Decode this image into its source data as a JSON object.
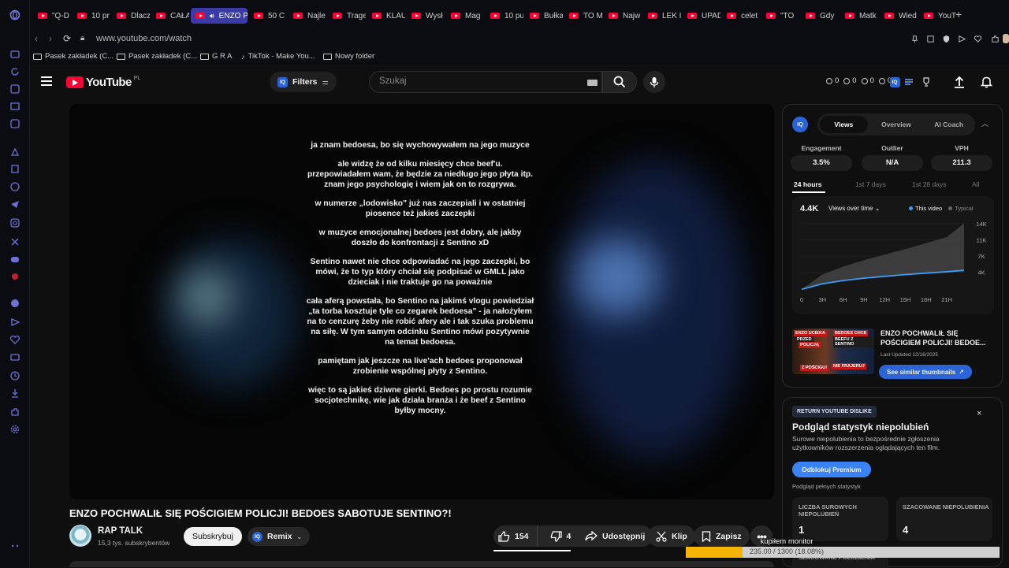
{
  "browser": {
    "tabs": [
      {
        "label": "\"Q-D",
        "active": false
      },
      {
        "label": "10 pr",
        "active": false
      },
      {
        "label": "Dlacz",
        "active": false
      },
      {
        "label": "CAŁA",
        "active": false
      },
      {
        "label": "ENZO P",
        "active": true
      },
      {
        "label": "50 C",
        "active": false
      },
      {
        "label": "Najle",
        "active": false
      },
      {
        "label": "Trage",
        "active": false
      },
      {
        "label": "KLAU",
        "active": false
      },
      {
        "label": "Wysł",
        "active": false
      },
      {
        "label": "Mag",
        "active": false
      },
      {
        "label": "10 pu",
        "active": false
      },
      {
        "label": "Bułka",
        "active": false
      },
      {
        "label": "TO M",
        "active": false
      },
      {
        "label": "Najw",
        "active": false
      },
      {
        "label": "LEK I",
        "active": false
      },
      {
        "label": "UPAD",
        "active": false
      },
      {
        "label": "celet",
        "active": false
      },
      {
        "label": "\"TO",
        "active": false
      },
      {
        "label": "Gdy",
        "active": false
      },
      {
        "label": "Matk",
        "active": false
      },
      {
        "label": "Wied",
        "active": false
      },
      {
        "label": "YouT",
        "active": false
      }
    ],
    "url": "www.youtube.com/watch",
    "bookmarks": [
      {
        "label": "Pasek zakładek (C...",
        "icon": "folder-icon"
      },
      {
        "label": "Pasek zakładek (C...",
        "icon": "folder-icon"
      },
      {
        "label": "G R A",
        "icon": "folder-icon"
      },
      {
        "label": "TikTok - Make You...",
        "icon": "tiktok-icon"
      },
      {
        "label": "Nowy folder",
        "icon": "folder-icon"
      }
    ]
  },
  "youtube": {
    "logo_region": "PL",
    "logo_text": "YouTube",
    "filters_label": "Filters",
    "search_placeholder": "Szukaj",
    "counters": [
      "0",
      "0",
      "0",
      "0"
    ],
    "video": {
      "title": "ENZO POCHWALIŁ SIĘ POŚCIGIEM POLICJI! BEDOES SABOTUJE SENTINO?!",
      "caption_paragraphs": [
        "ja znam bedoesa, bo się wychowywałem na jego muzyce",
        "ale widzę że od kilku miesięcy chce beef'u. przepowiadałem wam, że będzie za niedługo jego płyta itp. znam jego psychologię i wiem jak on to rozgrywa.",
        "w numerze „lodowisko\" już nas zaczepiali i w ostatniej piosence też jakieś zaczepki",
        "w muzyce emocjonalnej bedoes jest dobry, ale jakby doszło do konfrontacji z Sentino xD",
        "Sentino nawet nie chce odpowiadać na jego zaczepki, bo mówi, że to typ który chciał się podpisać w GMLL jako dzieciak i nie traktuje go na poważnie",
        "cała aferą powstała, bo Sentino na jakimś vlogu powiedział „ta torba kosztuje tyle co zegarek bedoesa\" - ja nałożyłem na to cenzurę żeby nie robić afery ale i tak szuka problemu na siłę. W tym samym odcinku Sentino mówi pozytywnie na temat bedoesa.",
        "pamiętam jak jeszcze na live'ach bedoes proponował zrobienie wspólnej płyty z Sentino.",
        "więc to są jakieś dziwne gierki. Bedoes po prostu rozumie socjotechnikę, wie jak działa branża i że beef z Sentino byłby mocny."
      ]
    },
    "channel": {
      "name": "RAP TALK",
      "subscribers": "15,3 tys. subskrybentów",
      "subscribe_label": "Subskrybuj",
      "remix_label": "Remix"
    },
    "actions": {
      "likes": "154",
      "dislikes": "4",
      "share_label": "Udostępnij",
      "clip_label": "Klip",
      "save_label": "Zapisz"
    }
  },
  "vidiq": {
    "tabs": [
      "Views",
      "Overview",
      "AI Coach"
    ],
    "active_tab": "Views",
    "stats": [
      {
        "label": "Engagement",
        "value": "3.5%"
      },
      {
        "label": "Outlier",
        "value": "N/A"
      },
      {
        "label": "VPH",
        "value": "211.3"
      }
    ],
    "ranges": [
      "24 hours",
      "1st 7 days",
      "1st 28 days",
      "All"
    ],
    "active_range": "24 hours",
    "big_value": "4.4K",
    "metric_label": "Views over time",
    "legend": {
      "this_video": "This video",
      "typical": "Typical"
    },
    "thumb_title": "ENZO POCHWALIŁ SIĘ POŚCIGIEM POLICJI! BEDOE...",
    "thumb_overlay": [
      "ENZO UCIEKA",
      "BEDOES CHCE",
      "PRZED",
      "POLICJĄ",
      "BEEFU Z SENTINO",
      "NIE FRAJERUJ",
      "Z POŚCIGU!"
    ],
    "last_updated": "Last Updated 12/16/2025",
    "similar_label": "See similar thumbnails",
    "accent": "#2a64d6"
  },
  "chart_data": {
    "type": "area",
    "x": [
      "0",
      "3H",
      "6H",
      "9H",
      "12H",
      "15H",
      "18H",
      "21H"
    ],
    "y_ticks": [
      "4K",
      "7K",
      "11K",
      "14K"
    ],
    "ylim": [
      0,
      15000
    ],
    "series": [
      {
        "name": "This video",
        "color": "#3b9ef5",
        "values": [
          300,
          1500,
          2200,
          2700,
          3100,
          3500,
          3800,
          4100,
          4400
        ]
      },
      {
        "name": "Typical",
        "color": "#555555",
        "values": [
          300,
          3500,
          5200,
          6600,
          7800,
          9000,
          10300,
          11600,
          14600
        ]
      }
    ],
    "x_values": [
      0,
      3,
      6,
      9,
      12,
      15,
      18,
      21,
      23.5
    ]
  },
  "ryd": {
    "badge": "RETURN YOUTUBE DISLIKE",
    "title": "Podgląd statystyk niepolubień",
    "description": "Surowe niepolubienia to bezpośrednie zgłoszenia użytkowników rozszerzenia oglądających ten film.",
    "unlock_label": "Odblokuj Premium",
    "preview_label": "Podgląd pełnych statystyk",
    "cards": [
      {
        "label": "LICZBA SUROWYCH NIEPOLUBIEŃ",
        "value": "1"
      },
      {
        "label": "SZACOWANE NIEPOLUBIENIA",
        "value": "4"
      },
      {
        "label": "SZACOWANE POLUBIENIA",
        "value": ""
      }
    ]
  },
  "download_overlay": {
    "label": "kupiłem monitor",
    "progress_text": "235.00 / 1300 (18.08%)",
    "progress_fraction": 0.1808,
    "color": "#f5b400"
  }
}
